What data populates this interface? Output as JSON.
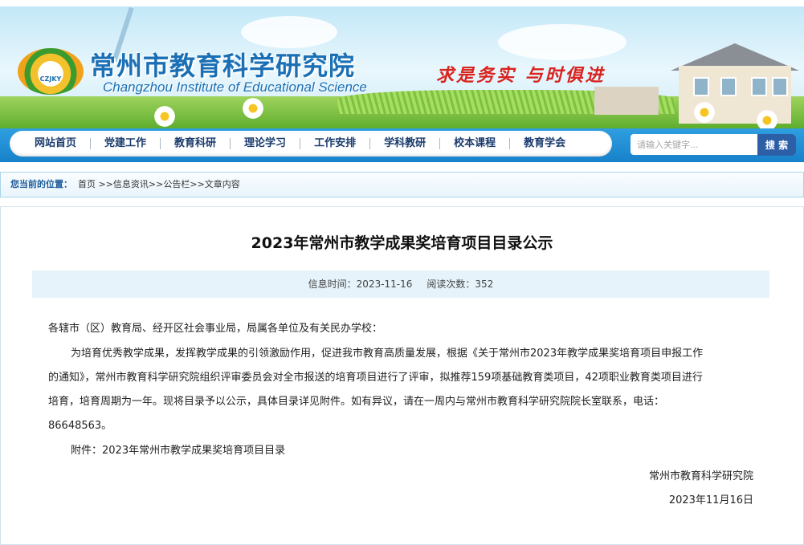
{
  "header": {
    "logo_text": "CZJKY",
    "site_title_cn": "常州市教育科学研究院",
    "site_title_en": "Changzhou Institute of Educational Science",
    "slogan": "求是务实  与时俱进"
  },
  "nav": {
    "items": [
      "网站首页",
      "党建工作",
      "教育科研",
      "理论学习",
      "工作安排",
      "学科教研",
      "校本课程",
      "教育学会"
    ]
  },
  "search": {
    "placeholder": "请输入关键字...",
    "button_label": "搜 索"
  },
  "breadcrumb": {
    "label": "您当前的位置：",
    "trail": "首页 >>信息资讯>>公告栏>>文章内容"
  },
  "article": {
    "title": "2023年常州市教学成果奖培育项目目录公示",
    "meta_date": "信息时间：2023-11-16",
    "meta_views": "阅读次数：352",
    "salutation": "各辖市（区）教育局、经开区社会事业局，局属各单位及有关民办学校：",
    "lines": [
      "为培育优秀教学成果，发挥教学成果的引领激励作用，促进我市教育高质量发展，根据《关于常州市2023年教学成果奖培育项目申报工作",
      "的通知》，常州市教育科学研究院组织评审委员会对全市报送的培育项目进行了评审，拟推荐159项基础教育类项目，42项职业教育类项目进行",
      "培育，培育周期为一年。现将目录予以公示，具体目录详见附件。如有异议，请在一周内与常州市教育科学研究院院长室联系，电话：",
      "86648563。"
    ],
    "attachment": "附件：2023年常州市教学成果奖培育项目目录",
    "signature_org": "常州市教育科学研究院",
    "signature_date": "2023年11月16日"
  },
  "colors": {
    "nav_blue": "#1781c9",
    "title_blue": "#1a6fb5",
    "slogan_red": "#d8231e",
    "search_button": "#2d5fa7"
  }
}
